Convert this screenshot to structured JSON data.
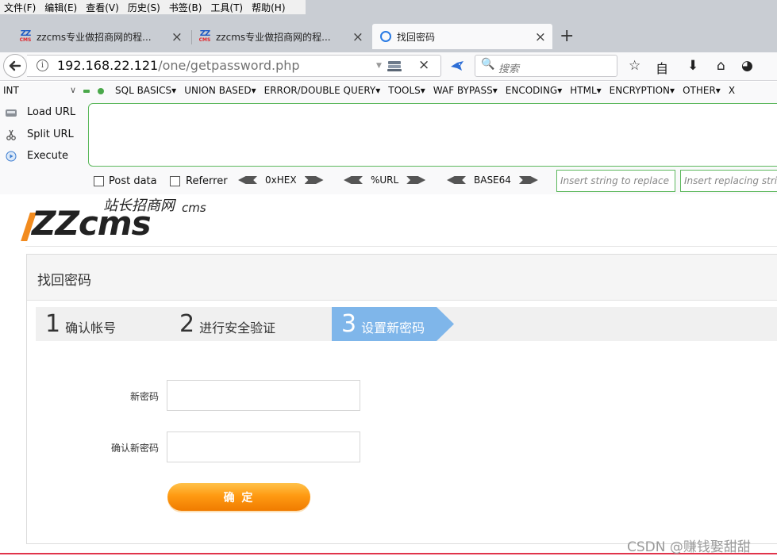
{
  "menu": [
    "文件(F)",
    "编辑(E)",
    "查看(V)",
    "历史(S)",
    "书签(B)",
    "工具(T)",
    "帮助(H)"
  ],
  "tabs": [
    {
      "title": "zzcms专业做招商网的程...",
      "favicon_top": "ZZ",
      "favicon_bottom": "CMS"
    },
    {
      "title": "zzcms专业做招商网的程...",
      "favicon_top": "ZZ",
      "favicon_bottom": "CMS"
    },
    {
      "title": "找回密码"
    }
  ],
  "tab_close": "×",
  "new_tab": "+",
  "navbar": {
    "url_host": "192.168.22.121",
    "url_path": "/one/getpassword.php",
    "url_info": "i",
    "url_dropdown": "▼",
    "url_clear": "×",
    "search_placeholder": "搜索",
    "search_icon": "🔍"
  },
  "toolbar_icons": [
    "☆",
    "自",
    "⬇",
    "⌂",
    "◕"
  ],
  "hackbar": {
    "select_value": "INT",
    "select_arrow": "∨",
    "menu": [
      "SQL BASICS▾",
      "UNION BASED▾",
      "ERROR/DOUBLE QUERY▾",
      "TOOLS▾",
      "WAF BYPASS▾",
      "ENCODING▾",
      "HTML▾",
      "ENCRYPTION▾",
      "OTHER▾",
      "X"
    ],
    "side": [
      {
        "label": "Load URL",
        "icon": "load-icon"
      },
      {
        "label": "Split URL",
        "icon": "scissors-icon"
      },
      {
        "label": "Execute",
        "icon": "play-icon"
      }
    ],
    "checks": [
      {
        "label": "Post data",
        "checked": false
      },
      {
        "label": "Referrer",
        "checked": false
      }
    ],
    "encoders": [
      "0xHEX",
      "%URL",
      "BASE64"
    ],
    "replace_placeholder": "Insert string to replace",
    "replacing_placeholder": "Insert replacing string"
  },
  "logo": {
    "main": "ZZcms",
    "sub": "站长招商网",
    "suffix": "cms"
  },
  "panel_title": "找回密码",
  "steps": [
    {
      "num": "1",
      "label": "确认帐号",
      "active": false
    },
    {
      "num": "2",
      "label": "进行安全验证",
      "active": false
    },
    {
      "num": "3",
      "label": "设置新密码",
      "active": true
    }
  ],
  "form": {
    "new_password_label": "新密码",
    "confirm_password_label": "确认新密码",
    "submit_label": "确 定"
  },
  "colors": {
    "accent_step": "#7fb6ea",
    "submit_orange": "#ff9a12",
    "hackbar_green": "#5cb85c"
  },
  "watermark": "CSDN @赚钱娶甜甜"
}
